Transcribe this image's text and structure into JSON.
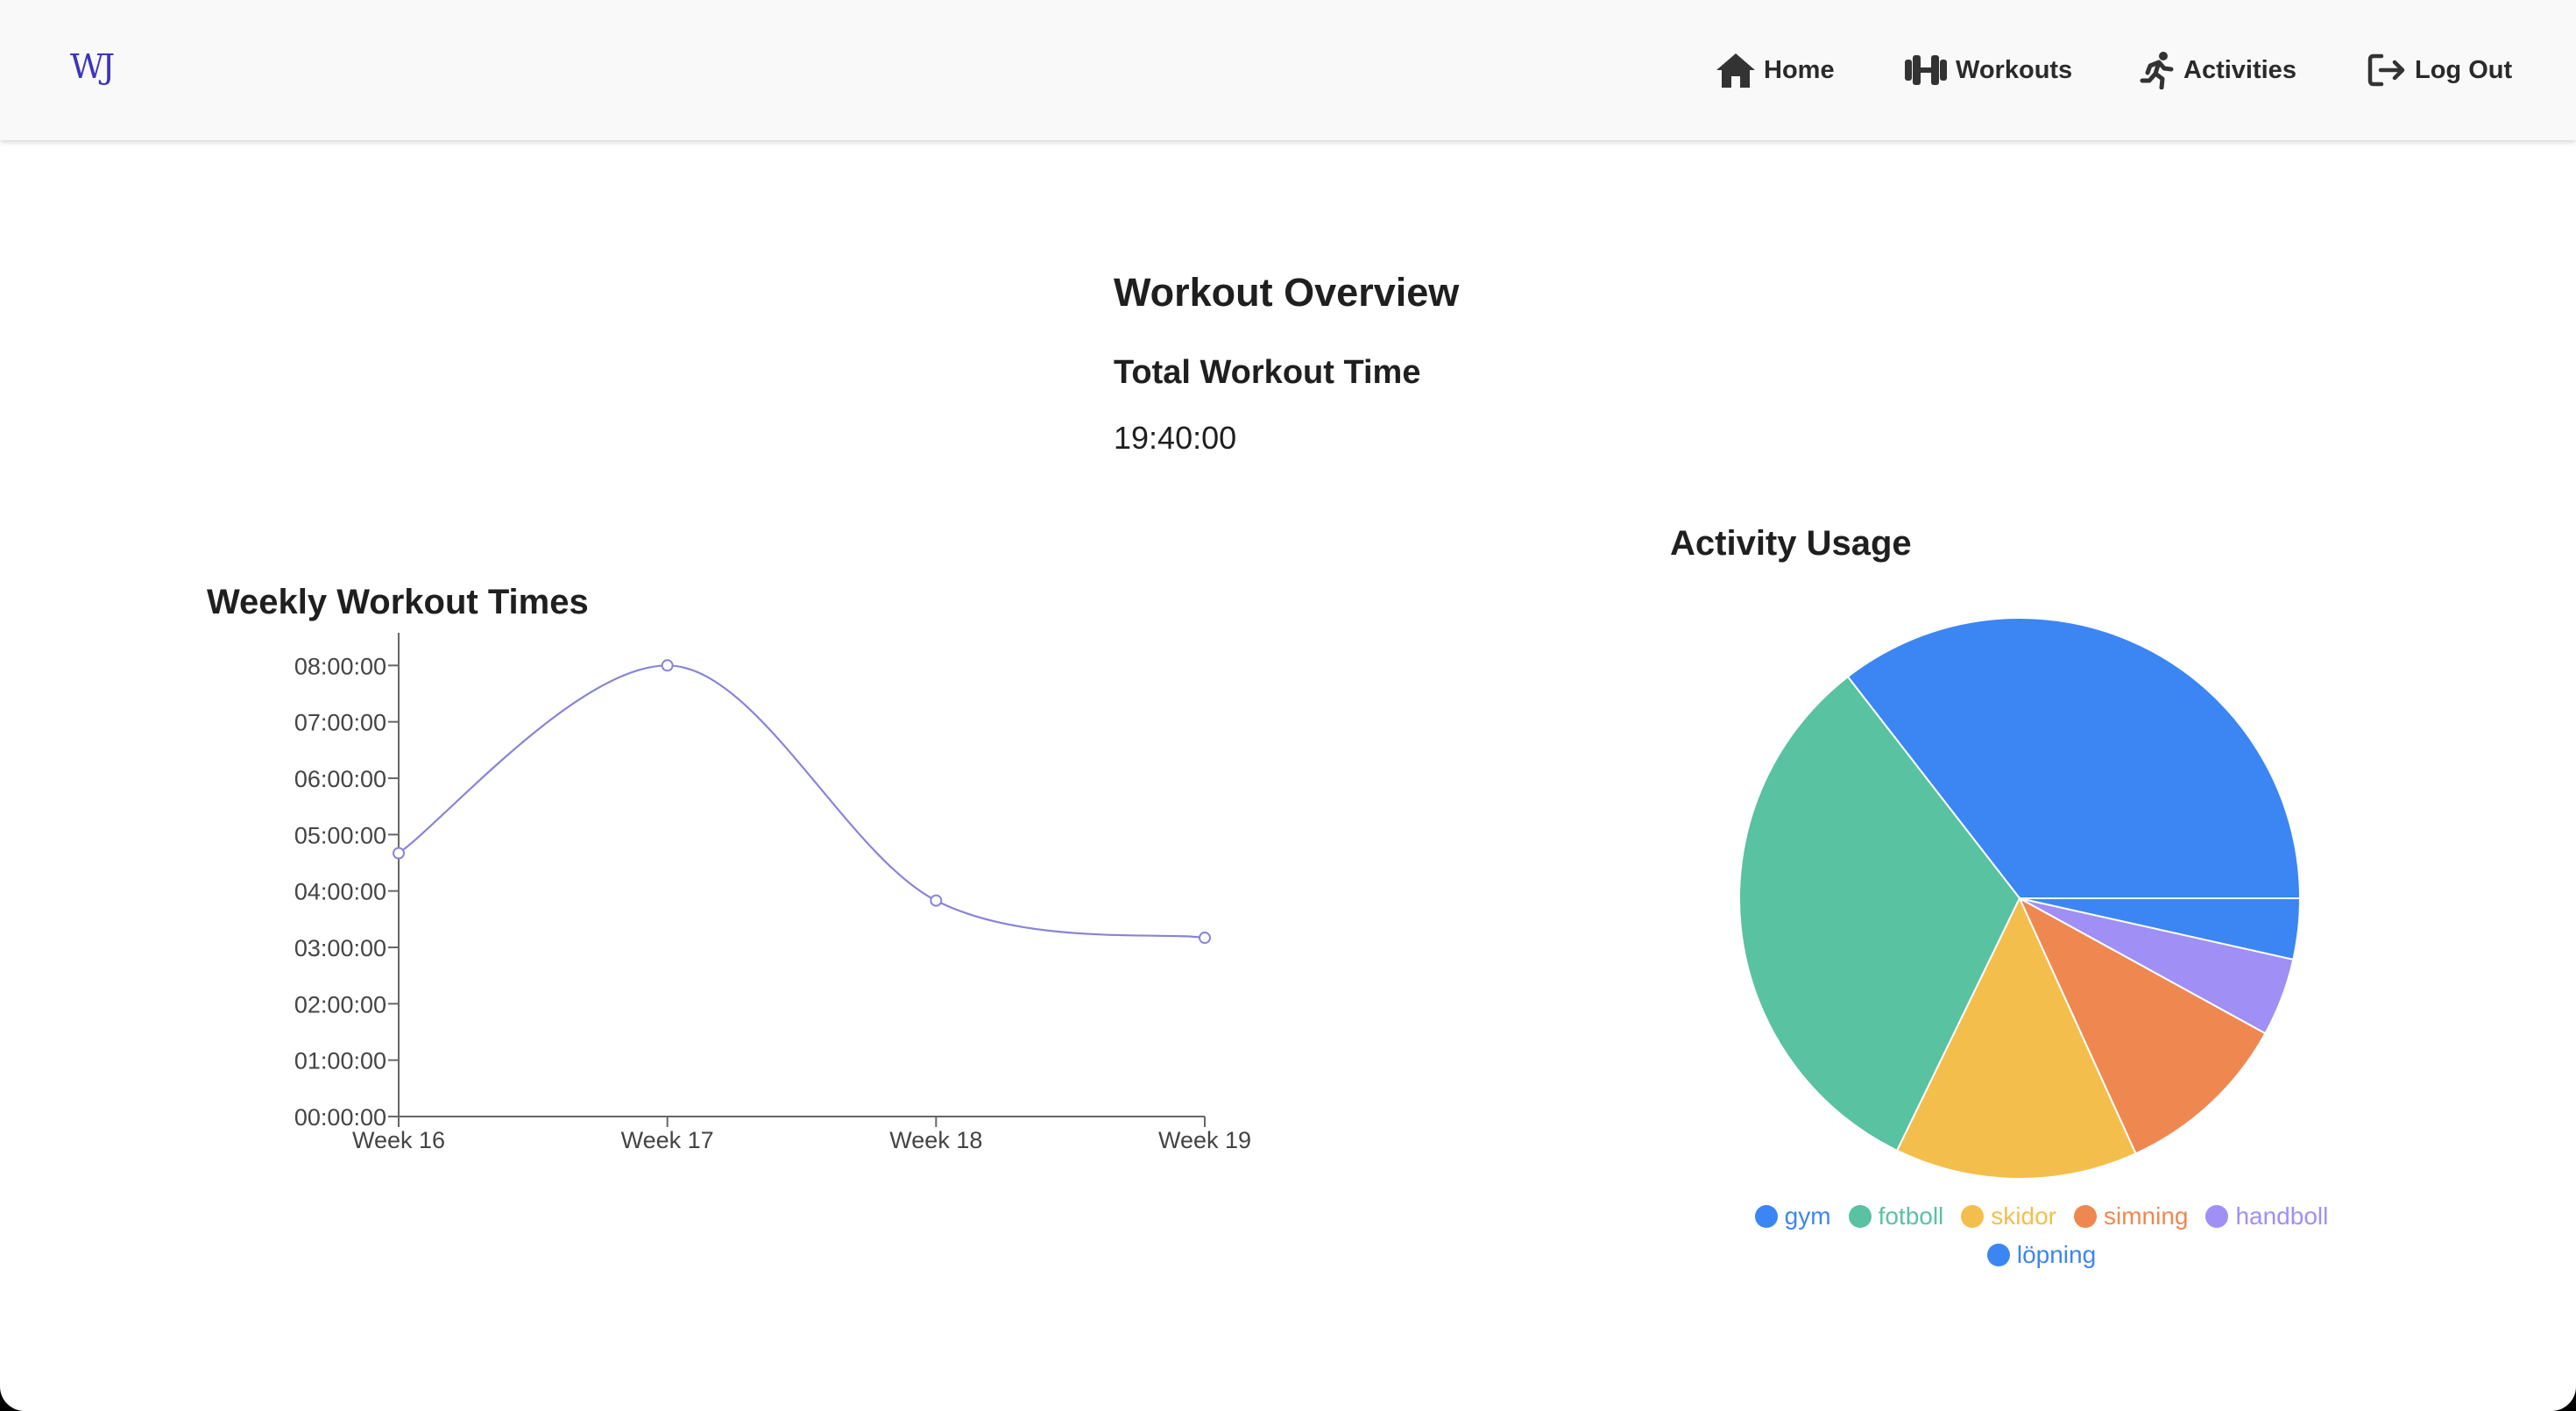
{
  "app": {
    "logo": "WJ"
  },
  "nav": {
    "items": [
      {
        "label": "Home",
        "icon": "home-icon"
      },
      {
        "label": "Workouts",
        "icon": "dumbbell-icon"
      },
      {
        "label": "Activities",
        "icon": "running-icon"
      },
      {
        "label": "Log Out",
        "icon": "logout-icon"
      }
    ]
  },
  "overview": {
    "title": "Workout Overview",
    "total_label": "Total Workout Time",
    "total_value": "19:40:00"
  },
  "weekly": {
    "title": "Weekly Workout Times",
    "line_color": "#8884d8"
  },
  "activity": {
    "title": "Activity Usage"
  },
  "chart_data": [
    {
      "type": "line",
      "title": "Weekly Workout Times",
      "categories": [
        "Week 16",
        "Week 17",
        "Week 18",
        "Week 19"
      ],
      "values_hours": [
        4.67,
        8.0,
        3.83,
        3.17
      ],
      "y_ticks": [
        "00:00:00",
        "01:00:00",
        "02:00:00",
        "03:00:00",
        "04:00:00",
        "05:00:00",
        "06:00:00",
        "07:00:00",
        "08:00:00"
      ],
      "ylim": [
        0,
        8.3
      ],
      "color": "#8884d8"
    },
    {
      "type": "pie",
      "title": "Activity Usage",
      "slices": [
        {
          "label": "gym",
          "value": 35.5,
          "color": "#3b86f2"
        },
        {
          "label": "fotboll",
          "value": 32.3,
          "color": "#58c2a1"
        },
        {
          "label": "skidor",
          "value": 14.0,
          "color": "#f4be4c"
        },
        {
          "label": "simning",
          "value": 10.2,
          "color": "#ef8850"
        },
        {
          "label": "handboll",
          "value": 4.5,
          "color": "#a08ff4"
        },
        {
          "label": "löpning",
          "value": 3.5,
          "color": "#3b86f2"
        }
      ]
    }
  ]
}
